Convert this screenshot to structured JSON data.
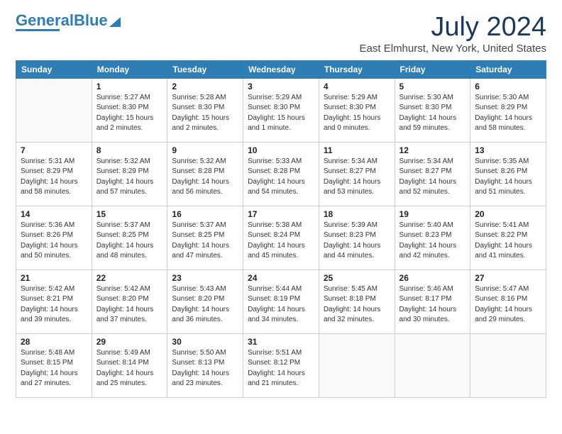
{
  "logo": {
    "text1": "General",
    "text2": "Blue"
  },
  "title": {
    "month_year": "July 2024",
    "location": "East Elmhurst, New York, United States"
  },
  "headers": [
    "Sunday",
    "Monday",
    "Tuesday",
    "Wednesday",
    "Thursday",
    "Friday",
    "Saturday"
  ],
  "weeks": [
    [
      {
        "day": "",
        "info": ""
      },
      {
        "day": "1",
        "info": "Sunrise: 5:27 AM\nSunset: 8:30 PM\nDaylight: 15 hours\nand 2 minutes."
      },
      {
        "day": "2",
        "info": "Sunrise: 5:28 AM\nSunset: 8:30 PM\nDaylight: 15 hours\nand 2 minutes."
      },
      {
        "day": "3",
        "info": "Sunrise: 5:29 AM\nSunset: 8:30 PM\nDaylight: 15 hours\nand 1 minute."
      },
      {
        "day": "4",
        "info": "Sunrise: 5:29 AM\nSunset: 8:30 PM\nDaylight: 15 hours\nand 0 minutes."
      },
      {
        "day": "5",
        "info": "Sunrise: 5:30 AM\nSunset: 8:30 PM\nDaylight: 14 hours\nand 59 minutes."
      },
      {
        "day": "6",
        "info": "Sunrise: 5:30 AM\nSunset: 8:29 PM\nDaylight: 14 hours\nand 58 minutes."
      }
    ],
    [
      {
        "day": "7",
        "info": "Sunrise: 5:31 AM\nSunset: 8:29 PM\nDaylight: 14 hours\nand 58 minutes."
      },
      {
        "day": "8",
        "info": "Sunrise: 5:32 AM\nSunset: 8:29 PM\nDaylight: 14 hours\nand 57 minutes."
      },
      {
        "day": "9",
        "info": "Sunrise: 5:32 AM\nSunset: 8:28 PM\nDaylight: 14 hours\nand 56 minutes."
      },
      {
        "day": "10",
        "info": "Sunrise: 5:33 AM\nSunset: 8:28 PM\nDaylight: 14 hours\nand 54 minutes."
      },
      {
        "day": "11",
        "info": "Sunrise: 5:34 AM\nSunset: 8:27 PM\nDaylight: 14 hours\nand 53 minutes."
      },
      {
        "day": "12",
        "info": "Sunrise: 5:34 AM\nSunset: 8:27 PM\nDaylight: 14 hours\nand 52 minutes."
      },
      {
        "day": "13",
        "info": "Sunrise: 5:35 AM\nSunset: 8:26 PM\nDaylight: 14 hours\nand 51 minutes."
      }
    ],
    [
      {
        "day": "14",
        "info": "Sunrise: 5:36 AM\nSunset: 8:26 PM\nDaylight: 14 hours\nand 50 minutes."
      },
      {
        "day": "15",
        "info": "Sunrise: 5:37 AM\nSunset: 8:25 PM\nDaylight: 14 hours\nand 48 minutes."
      },
      {
        "day": "16",
        "info": "Sunrise: 5:37 AM\nSunset: 8:25 PM\nDaylight: 14 hours\nand 47 minutes."
      },
      {
        "day": "17",
        "info": "Sunrise: 5:38 AM\nSunset: 8:24 PM\nDaylight: 14 hours\nand 45 minutes."
      },
      {
        "day": "18",
        "info": "Sunrise: 5:39 AM\nSunset: 8:23 PM\nDaylight: 14 hours\nand 44 minutes."
      },
      {
        "day": "19",
        "info": "Sunrise: 5:40 AM\nSunset: 8:23 PM\nDaylight: 14 hours\nand 42 minutes."
      },
      {
        "day": "20",
        "info": "Sunrise: 5:41 AM\nSunset: 8:22 PM\nDaylight: 14 hours\nand 41 minutes."
      }
    ],
    [
      {
        "day": "21",
        "info": "Sunrise: 5:42 AM\nSunset: 8:21 PM\nDaylight: 14 hours\nand 39 minutes."
      },
      {
        "day": "22",
        "info": "Sunrise: 5:42 AM\nSunset: 8:20 PM\nDaylight: 14 hours\nand 37 minutes."
      },
      {
        "day": "23",
        "info": "Sunrise: 5:43 AM\nSunset: 8:20 PM\nDaylight: 14 hours\nand 36 minutes."
      },
      {
        "day": "24",
        "info": "Sunrise: 5:44 AM\nSunset: 8:19 PM\nDaylight: 14 hours\nand 34 minutes."
      },
      {
        "day": "25",
        "info": "Sunrise: 5:45 AM\nSunset: 8:18 PM\nDaylight: 14 hours\nand 32 minutes."
      },
      {
        "day": "26",
        "info": "Sunrise: 5:46 AM\nSunset: 8:17 PM\nDaylight: 14 hours\nand 30 minutes."
      },
      {
        "day": "27",
        "info": "Sunrise: 5:47 AM\nSunset: 8:16 PM\nDaylight: 14 hours\nand 29 minutes."
      }
    ],
    [
      {
        "day": "28",
        "info": "Sunrise: 5:48 AM\nSunset: 8:15 PM\nDaylight: 14 hours\nand 27 minutes."
      },
      {
        "day": "29",
        "info": "Sunrise: 5:49 AM\nSunset: 8:14 PM\nDaylight: 14 hours\nand 25 minutes."
      },
      {
        "day": "30",
        "info": "Sunrise: 5:50 AM\nSunset: 8:13 PM\nDaylight: 14 hours\nand 23 minutes."
      },
      {
        "day": "31",
        "info": "Sunrise: 5:51 AM\nSunset: 8:12 PM\nDaylight: 14 hours\nand 21 minutes."
      },
      {
        "day": "",
        "info": ""
      },
      {
        "day": "",
        "info": ""
      },
      {
        "day": "",
        "info": ""
      }
    ]
  ]
}
